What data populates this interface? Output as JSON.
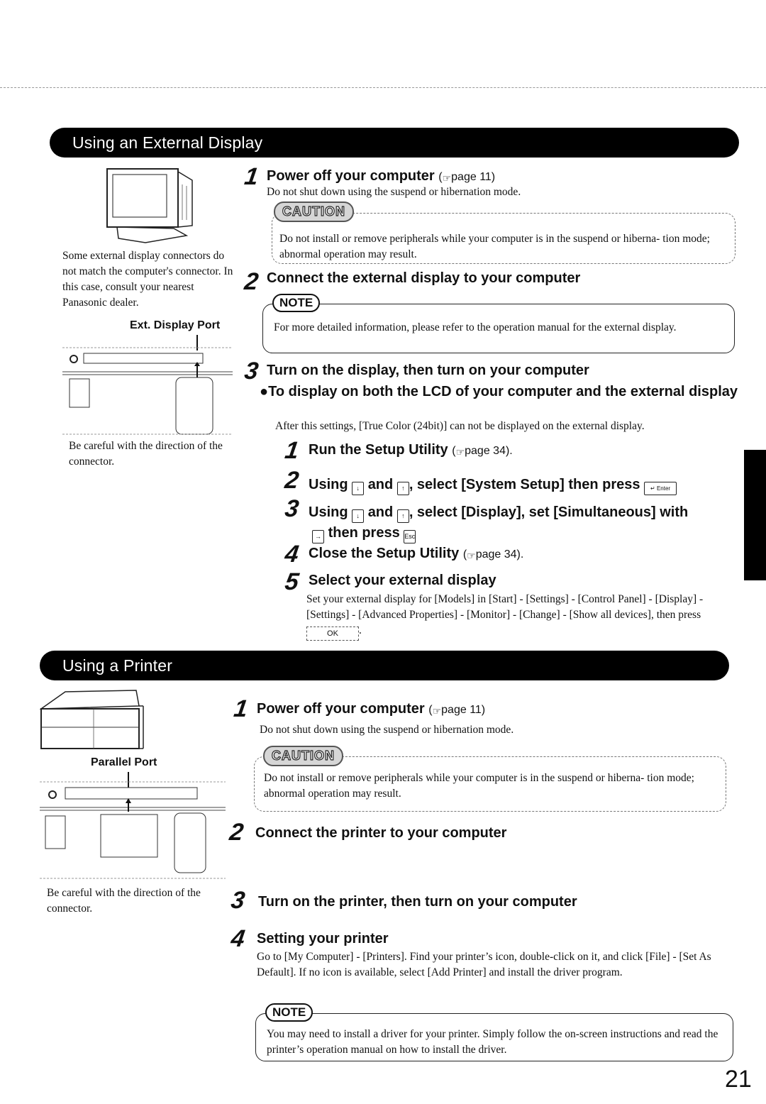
{
  "page_number": "21",
  "external_display": {
    "section_title": "Using an External Display",
    "side_note": "Some external display connectors do not match the computer's connector. In this case, consult your nearest Panasonic dealer.",
    "port_label": "Ext. Display Port",
    "port_caption": "Be careful with the direction of the connector.",
    "steps": [
      {
        "num": "1",
        "title": "Power off your computer",
        "ref_prefix": "(",
        "ref": "page 11)",
        "body": "Do not shut down using the suspend or hibernation mode."
      },
      {
        "num": "2",
        "title": "Connect the external display to your computer"
      },
      {
        "num": "3",
        "title": "Turn on the display, then turn on your computer"
      }
    ],
    "caution": {
      "label": "CAUTION",
      "text": "Do not install or remove peripherals while your computer is in the suspend or hiberna- tion mode; abnormal operation may result."
    },
    "note": {
      "label": "NOTE",
      "text": "For more detailed information, please refer to the operation manual for the external display."
    },
    "both_lcd": {
      "bullet": "●",
      "heading": "To display on both the LCD of your computer and the external display",
      "body": "After this settings, [True Color (24bit)] can not be displayed on the external display.",
      "substeps": [
        {
          "num": "1",
          "text": "Run the Setup Utility",
          "ref": "page 34)."
        },
        {
          "num": "2",
          "pre": "Using",
          "key1": "↓",
          "mid": "and",
          "key2": "↑",
          "post": ", select [System Setup] then press",
          "key3": "↵ Enter"
        },
        {
          "num": "3",
          "pre": "Using",
          "key1": "↓",
          "mid": "and",
          "key2": "↑",
          "post": ", select [Display], set [Simultaneous] with",
          "key3": "→",
          "line2": "then press",
          "key4": "Esc"
        },
        {
          "num": "4",
          "text": "Close the Setup Utility",
          "ref": "page 34)."
        },
        {
          "num": "5",
          "text": "Select your external display",
          "body": "Set your external display for  [Models] in [Start] - [Settings] - [Control Panel] - [Display] - [Settings] - [Advanced Properties] - [Monitor] - [Change] - [Show all devices], then press",
          "ok_label": "OK",
          "body_end": "."
        }
      ]
    }
  },
  "printer": {
    "section_title": "Using a Printer",
    "port_label": "Parallel Port",
    "port_caption": "Be careful with the direction of the connector.",
    "steps": [
      {
        "num": "1",
        "title": "Power off your computer",
        "ref": "page 11)",
        "body": "Do not shut down using the suspend or hibernation mode."
      },
      {
        "num": "2",
        "title": "Connect the printer to your computer"
      },
      {
        "num": "3",
        "title": "Turn on the printer, then turn on your computer"
      },
      {
        "num": "4",
        "title": "Setting your printer",
        "body": "Go to [My Computer] - [Printers].  Find your printer’s icon, double-click on it, and click [File] - [Set As Default].  If no icon is available, select [Add Printer] and install the driver program."
      }
    ],
    "caution": {
      "label": "CAUTION",
      "text": "Do not install or remove peripherals while your computer is in the suspend or hiberna- tion mode; abnormal operation may result."
    },
    "note": {
      "label": "NOTE",
      "text": "You may need to install a driver for your printer.  Simply follow the on-screen instructions and read the printer’s operation manual on how to install the driver."
    }
  },
  "icons": {
    "page_ref": "☞"
  }
}
